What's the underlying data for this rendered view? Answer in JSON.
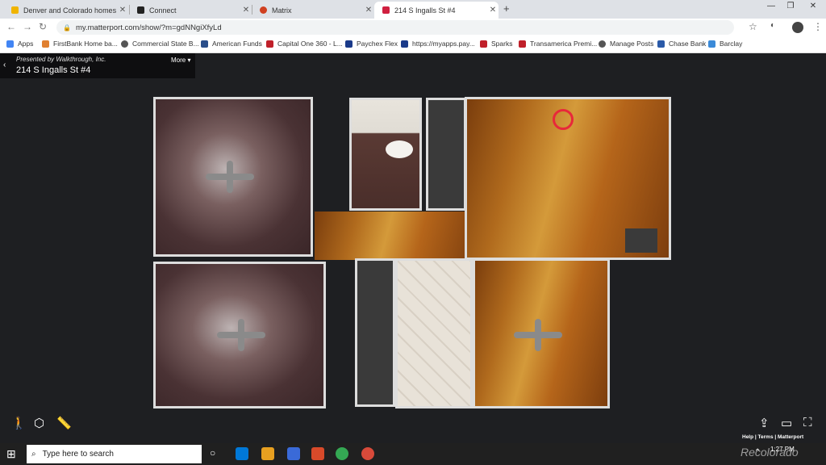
{
  "browser": {
    "tabs": [
      {
        "label": "Denver and Colorado homes listi",
        "color": "#f0b400"
      },
      {
        "label": "Connect",
        "color": "#222222"
      },
      {
        "label": "Matrix",
        "color": "#d04020"
      },
      {
        "label": "214 S Ingalls St #4",
        "color": "#d02040"
      }
    ],
    "new_tab": "+",
    "url": "my.matterport.com/show/?m=gdNNgiXfyLd"
  },
  "bookmarks": [
    {
      "label": "Apps",
      "color": "#4285f4"
    },
    {
      "label": "FirstBank Home ba...",
      "color": "#e08030"
    },
    {
      "label": "Commercial State B...",
      "color": "#555555"
    },
    {
      "label": "American Funds",
      "color": "#2a4e8a"
    },
    {
      "label": "Capital One 360 - L...",
      "color": "#c0202a"
    },
    {
      "label": "Paychex Flex",
      "color": "#1a3a8a"
    },
    {
      "label": "https://myapps.pay...",
      "color": "#1a3a8a"
    },
    {
      "label": "Sparks",
      "color": "#c0202a"
    },
    {
      "label": "Transamerica Premi...",
      "color": "#c0202a"
    },
    {
      "label": "Manage Posts",
      "color": "#555555"
    },
    {
      "label": "Chase Bank",
      "color": "#2a5aa8"
    },
    {
      "label": "Barclay",
      "color": "#3a8ad8"
    }
  ],
  "viewer": {
    "presented_by": "Presented by Walkthrough, Inc.",
    "address": "214 S Ingalls St #4",
    "more": "More",
    "help": "Help",
    "terms": "Terms",
    "brand": "Matterport"
  },
  "taskbar": {
    "search_placeholder": "Type here to search",
    "time": "1:27 PM"
  },
  "watermark": "Recolorado"
}
